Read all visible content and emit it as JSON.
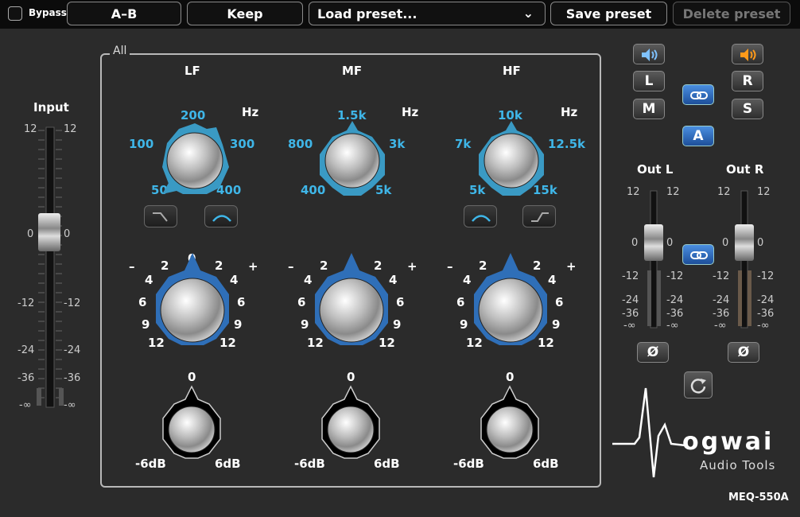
{
  "topbar": {
    "bypass_label": "Bypass",
    "ab_label": "A–B",
    "keep_label": "Keep",
    "load_label": "Load preset...",
    "save_label": "Save preset",
    "delete_label": "Delete preset"
  },
  "group_label": "All",
  "input": {
    "label": "Input",
    "scale": [
      "12",
      "0",
      "-12",
      "-24",
      "-36",
      "-∞"
    ]
  },
  "bands": [
    {
      "name": "LF",
      "hz": "Hz",
      "freqs": [
        "200",
        "100",
        "300",
        "50",
        "400"
      ]
    },
    {
      "name": "MF",
      "hz": "Hz",
      "freqs": [
        "1.5k",
        "800",
        "3k",
        "400",
        "5k"
      ]
    },
    {
      "name": "HF",
      "hz": "Hz",
      "freqs": [
        "10k",
        "7k",
        "12.5k",
        "5k",
        "15k"
      ]
    }
  ],
  "gain": {
    "minus": "–",
    "plus": "+",
    "ticks": [
      "0",
      "2",
      "4",
      "6",
      "9",
      "12"
    ]
  },
  "trim": {
    "zero": "0",
    "min": "-6dB",
    "max": "6dB"
  },
  "right": {
    "L": "L",
    "M": "M",
    "R": "R",
    "S": "S",
    "A": "A",
    "out_l": "Out L",
    "out_r": "Out R",
    "scale": [
      "12",
      "0",
      "-12",
      "-24",
      "-36",
      "-∞"
    ],
    "phase": "Ø"
  },
  "brand": {
    "name": "ogwai",
    "sub": "Audio Tools",
    "model": "MEQ-550A"
  },
  "colors": {
    "accent_blue": "#3fb6e8",
    "knob_blue": "#2f6fb8",
    "speaker_orange": "#ff9a1a"
  }
}
